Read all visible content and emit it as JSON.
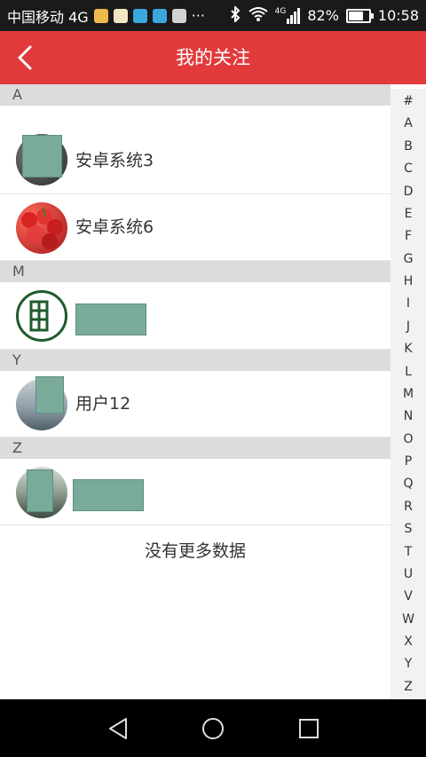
{
  "status_bar": {
    "carrier": "中国移动 4G",
    "battery": "82%",
    "time": "10:58",
    "net_label": "4G",
    "battery_level": 0.82,
    "icons": [
      "qq-icon",
      "app-icon",
      "bluetooth-icon",
      "wifi-icon",
      "signal-icon",
      "battery-icon",
      "more-icon"
    ]
  },
  "header": {
    "title": "我的关注",
    "back_icon": "chevron-left-icon"
  },
  "sections": [
    {
      "letter": "A",
      "items": [
        {
          "name": "安卓系统3",
          "avatar_color": "#3b3b3b"
        },
        {
          "name": "安卓系统6",
          "avatar_color": "#c8262a"
        }
      ]
    },
    {
      "letter": "M",
      "items": [
        {
          "name": "",
          "avatar_color": "#1f5a2c"
        }
      ]
    },
    {
      "letter": "Y",
      "items": [
        {
          "name": "用户12",
          "avatar_color": "#6f7f88"
        }
      ]
    },
    {
      "letter": "Z",
      "items": [
        {
          "name": "",
          "avatar_color": "#5a6b5d"
        }
      ]
    }
  ],
  "footer": {
    "text": "没有更多数据"
  },
  "index": [
    "#",
    "A",
    "B",
    "C",
    "D",
    "E",
    "F",
    "G",
    "H",
    "I",
    "J",
    "K",
    "L",
    "M",
    "N",
    "O",
    "P",
    "Q",
    "R",
    "S",
    "T",
    "U",
    "V",
    "W",
    "X",
    "Y",
    "Z"
  ],
  "colors": {
    "header": "#e23a3a",
    "redaction": "#7aab9a"
  }
}
